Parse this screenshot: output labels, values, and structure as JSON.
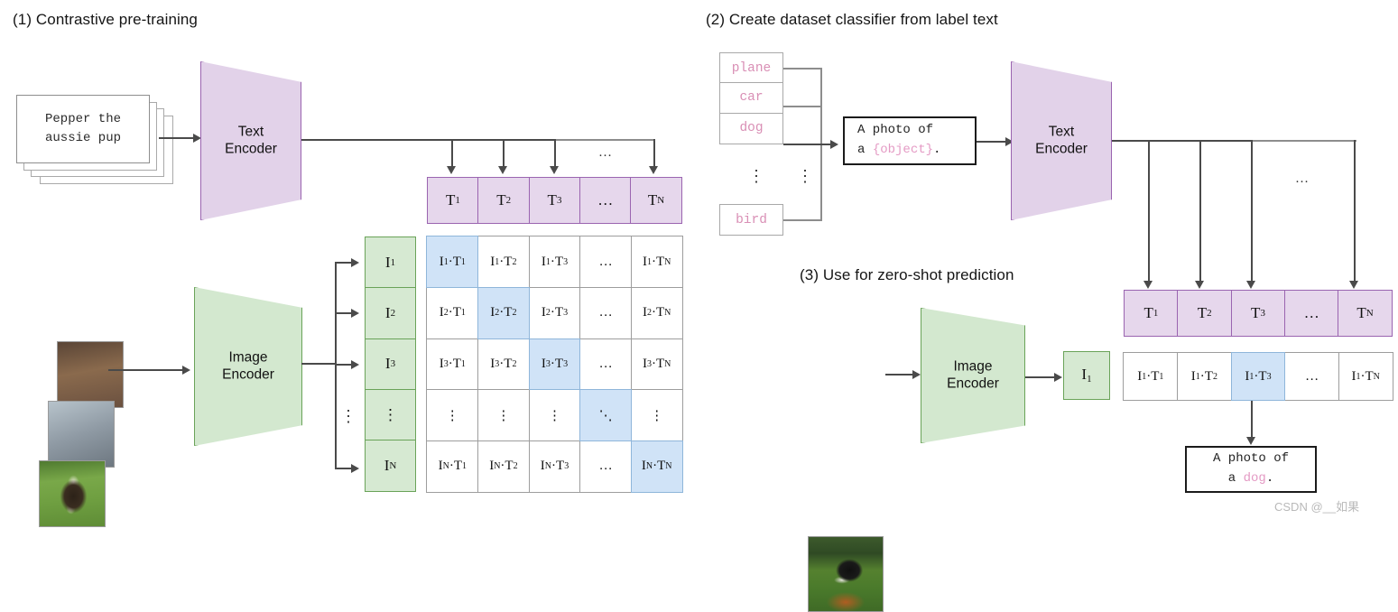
{
  "panels": {
    "p1": {
      "title": "(1) Contrastive pre-training"
    },
    "p2": {
      "title": "(2) Create dataset classifier from label text"
    },
    "p3": {
      "title": "(3) Use for zero-shot prediction"
    }
  },
  "encoders": {
    "text_line1": "Text",
    "text_line2": "Encoder",
    "image_line1": "Image",
    "image_line2": "Encoder"
  },
  "sample_text": {
    "line1": "Pepper the",
    "line2": "aussie pup"
  },
  "t_row": [
    {
      "base": "T",
      "sub": "1"
    },
    {
      "base": "T",
      "sub": "2"
    },
    {
      "base": "T",
      "sub": "3"
    },
    {
      "base": "…",
      "sub": ""
    },
    {
      "base": "T",
      "sub": "N"
    }
  ],
  "i_col": [
    {
      "base": "I",
      "sub": "1"
    },
    {
      "base": "I",
      "sub": "2"
    },
    {
      "base": "I",
      "sub": "3"
    },
    {
      "base": "⋮",
      "sub": ""
    },
    {
      "base": "I",
      "sub": "N"
    }
  ],
  "matrix": {
    "rows": [
      [
        {
          "t": "I1·T1",
          "hi": true
        },
        {
          "t": "I1·T2",
          "hi": false
        },
        {
          "t": "I1·T3",
          "hi": false
        },
        {
          "t": "…",
          "hi": false
        },
        {
          "t": "I1·TN",
          "hi": false
        }
      ],
      [
        {
          "t": "I2·T1",
          "hi": false
        },
        {
          "t": "I2·T2",
          "hi": true
        },
        {
          "t": "I2·T3",
          "hi": false
        },
        {
          "t": "…",
          "hi": false
        },
        {
          "t": "I2·TN",
          "hi": false
        }
      ],
      [
        {
          "t": "I3·T1",
          "hi": false
        },
        {
          "t": "I3·T2",
          "hi": false
        },
        {
          "t": "I3·T3",
          "hi": true
        },
        {
          "t": "…",
          "hi": false
        },
        {
          "t": "I3·TN",
          "hi": false
        }
      ],
      [
        {
          "t": "⋮",
          "hi": false
        },
        {
          "t": "⋮",
          "hi": false
        },
        {
          "t": "⋮",
          "hi": false
        },
        {
          "t": "⋱",
          "hi": true
        },
        {
          "t": "⋮",
          "hi": false
        }
      ],
      [
        {
          "t": "IN·T1",
          "hi": false
        },
        {
          "t": "IN·T2",
          "hi": false
        },
        {
          "t": "IN·T3",
          "hi": false
        },
        {
          "t": "…",
          "hi": false
        },
        {
          "t": "IN·TN",
          "hi": true
        }
      ]
    ]
  },
  "labels": {
    "plane": "plane",
    "car": "car",
    "dog": "dog",
    "bird": "bird",
    "ellipsis": "⋮"
  },
  "prompt_template": {
    "line1": "A photo of",
    "line2_prefix": "a ",
    "line2_slot": "{object}",
    "line2_suffix": "."
  },
  "prediction": {
    "line1": "A photo of",
    "line2_prefix": "a ",
    "line2_slot": "dog",
    "line2_suffix": "."
  },
  "p3_t_row": [
    {
      "base": "T",
      "sub": "1"
    },
    {
      "base": "T",
      "sub": "2"
    },
    {
      "base": "T",
      "sub": "3"
    },
    {
      "base": "…",
      "sub": ""
    },
    {
      "base": "T",
      "sub": "N"
    }
  ],
  "p3_i_cell": {
    "base": "I",
    "sub": "1"
  },
  "p3_scores": [
    {
      "t": "I1·T1",
      "hi": false
    },
    {
      "t": "I1·T2",
      "hi": false
    },
    {
      "t": "I1·T3",
      "hi": true
    },
    {
      "t": "…",
      "hi": false
    },
    {
      "t": "I1·TN",
      "hi": false
    }
  ],
  "ellipsis_mark": "…",
  "watermark": "CSDN @__如果",
  "colors": {
    "purple_fill": "#e6d7ec",
    "purple_stroke": "#9a64b0",
    "green_fill": "#d6e9d2",
    "green_stroke": "#6aa359",
    "highlight_blue": "#d0e3f7",
    "pink_text": "#d98fb5",
    "line": "#4a4a4a"
  }
}
